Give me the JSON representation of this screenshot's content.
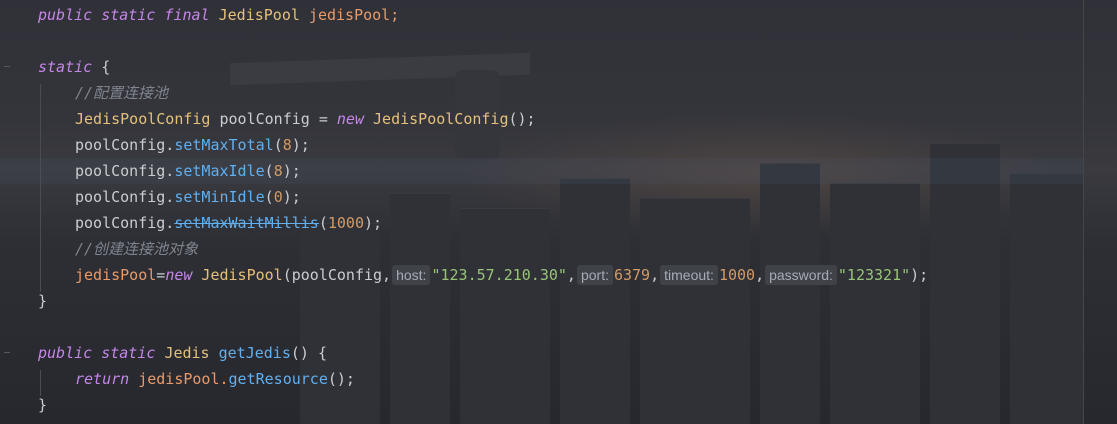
{
  "code": {
    "line1": {
      "kw": "public static final ",
      "type": "JedisPool",
      "name": " jedisPool;"
    },
    "line2": {
      "kw": "static",
      "rest": " {"
    },
    "line3": {
      "comment": "//配置连接池"
    },
    "line4": {
      "type": "JedisPoolConfig",
      "mid": " poolConfig = ",
      "kw": "new",
      "ctor": " JedisPoolConfig",
      "end": "();"
    },
    "line5": {
      "obj": "poolConfig.",
      "method": "setMaxTotal",
      "open": "(",
      "num": "8",
      "close": ");"
    },
    "line6": {
      "obj": "poolConfig.",
      "method": "setMaxIdle",
      "open": "(",
      "num": "8",
      "close": ");"
    },
    "line7": {
      "obj": "poolConfig.",
      "method": "setMinIdle",
      "open": "(",
      "num": "0",
      "close": ");"
    },
    "line8": {
      "obj": "poolConfig.",
      "method": "setMaxWaitMillis",
      "open": "(",
      "num": "1000",
      "close": ");"
    },
    "line9": {
      "comment": "//创建连接池对象"
    },
    "line10": {
      "var": "jedisPool",
      "eq": "=",
      "kw": "new",
      "ctor": " JedisPool",
      "open": "(poolConfig,",
      "hint_host": "host:",
      "host": "\"123.57.210.30\"",
      "c1": ",",
      "hint_port": "port:",
      "port": "6379",
      "c2": ",",
      "hint_timeout": "timeout:",
      "timeout": "1000",
      "c3": ",",
      "hint_password": "password:",
      "password": "\"123321\"",
      "end": ");"
    },
    "line11": {
      "brace": "}"
    },
    "line12": {
      "kw": "public static ",
      "type": "Jedis",
      "method": "getJedis",
      "rest": "() {"
    },
    "line13": {
      "kw": "return",
      "obj": " jedisPool.",
      "method": "getResource",
      "rest": "();"
    },
    "line14": {
      "brace": "}"
    }
  }
}
